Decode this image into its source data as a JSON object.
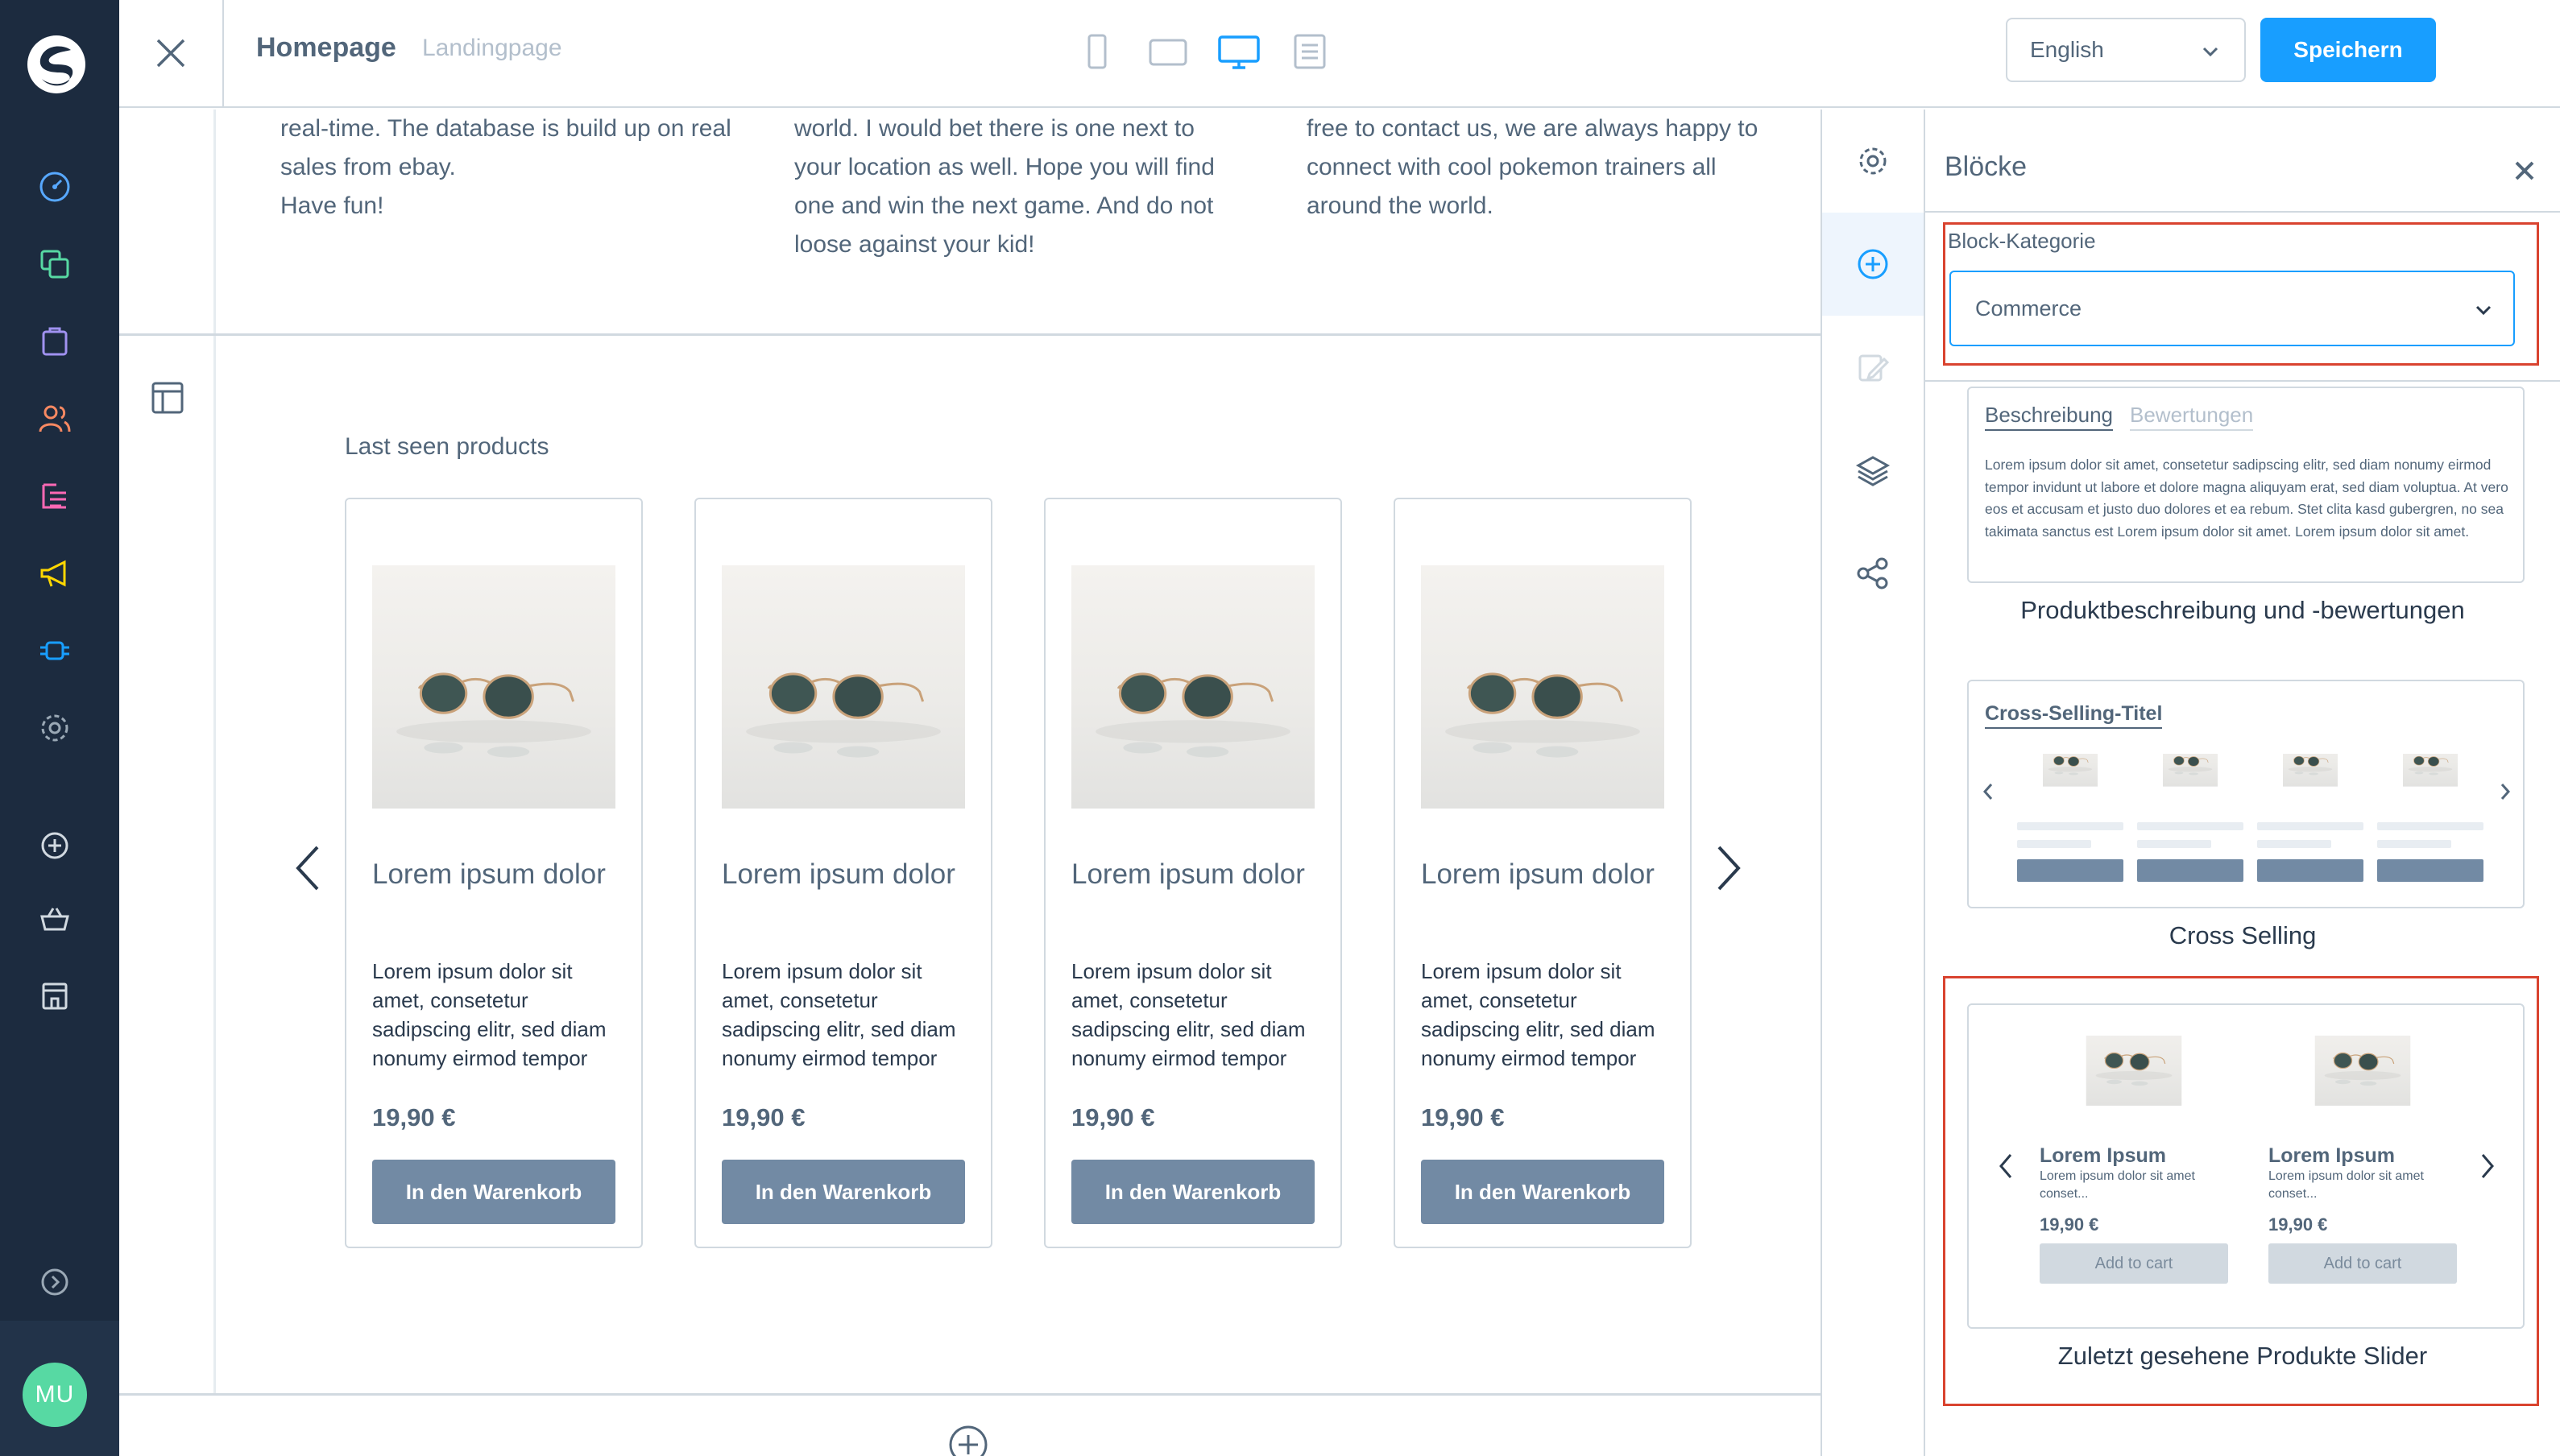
{
  "admin_nav": {
    "icons": [
      "dashboard-icon",
      "catalogue-icon",
      "orders-icon",
      "customers-icon",
      "content-icon",
      "marketing-icon",
      "extensions-icon",
      "settings-icon",
      "add-icon",
      "basket-icon",
      "storefront-icon",
      "expand-icon"
    ],
    "avatar_initials": "MU",
    "colors": {
      "background": "#1c2b3f",
      "avatar": "#57d9a3"
    }
  },
  "topbar": {
    "page_title": "Homepage",
    "page_type": "Landingpage",
    "devices": [
      "mobile-icon",
      "tablet-icon",
      "desktop-icon",
      "list-icon"
    ],
    "active_device": "desktop-icon",
    "language": "English",
    "save_label": "Speichern",
    "colors": {
      "accent": "#189eff"
    }
  },
  "canvas": {
    "text_columns": [
      {
        "lines": [
          "real-time. The database is build up on real",
          "sales from ebay.",
          "Have fun!"
        ]
      },
      {
        "lines": [
          "world. I would bet there is one next to",
          "your location as well. Hope you will find",
          "one and win the next game. And do not",
          "loose against your kid!"
        ]
      },
      {
        "lines": [
          "free to contact us, we are always happy to",
          "connect with cool pokemon trainers all",
          "around the world."
        ]
      }
    ],
    "section_title": "Last seen products",
    "products": [
      {
        "name": "Lorem ipsum dolor",
        "description": "Lorem ipsum dolor sit amet, consetetur sadipscing elitr, sed diam nonumy eirmod tempor",
        "price": "19,90 €",
        "button": "In den Warenkorb"
      },
      {
        "name": "Lorem ipsum dolor",
        "description": "Lorem ipsum dolor sit amet, consetetur sadipscing elitr, sed diam nonumy eirmod tempor",
        "price": "19,90 €",
        "button": "In den Warenkorb"
      },
      {
        "name": "Lorem ipsum dolor",
        "description": "Lorem ipsum dolor sit amet, consetetur sadipscing elitr, sed diam nonumy eirmod tempor",
        "price": "19,90 €",
        "button": "In den Warenkorb"
      },
      {
        "name": "Lorem ipsum dolor",
        "description": "Lorem ipsum dolor sit amet, consetetur sadipscing elitr, sed diam nonumy eirmod tempor",
        "price": "19,90 €",
        "button": "In den Warenkorb"
      }
    ]
  },
  "sidebar_tabs": {
    "items": [
      "settings-icon",
      "add-block-icon",
      "edit-icon",
      "layers-icon",
      "share-icon"
    ],
    "active": "add-block-icon"
  },
  "blocks_panel": {
    "title": "Blöcke",
    "category_label": "Block-Kategorie",
    "category_value": "Commerce",
    "blocks": [
      {
        "caption": "Produktbeschreibung und -bewertungen",
        "tabs": [
          "Beschreibung",
          "Bewertungen"
        ],
        "text": "Lorem ipsum dolor sit amet, consetetur sadipscing elitr, sed diam nonumy eirmod tempor invidunt ut labore et dolore magna aliquyam erat, sed diam voluptua. At vero eos et accusam et justo duo dolores et ea rebum. Stet clita kasd gubergren, no sea takimata sanctus est Lorem ipsum dolor sit amet. Lorem ipsum dolor sit amet."
      },
      {
        "caption": "Cross Selling",
        "title": "Cross-Selling-Titel"
      },
      {
        "caption": "Zuletzt gesehene Produkte Slider",
        "items": [
          {
            "name": "Lorem Ipsum",
            "description": "Lorem ipsum dolor sit amet conset...",
            "price": "19,90 €",
            "button": "Add to cart"
          },
          {
            "name": "Lorem Ipsum",
            "description": "Lorem ipsum dolor sit amet conset...",
            "price": "19,90 €",
            "button": "Add to cart"
          }
        ]
      }
    ],
    "colors": {
      "highlight": "#d9432f",
      "button": "#728aa4"
    }
  }
}
